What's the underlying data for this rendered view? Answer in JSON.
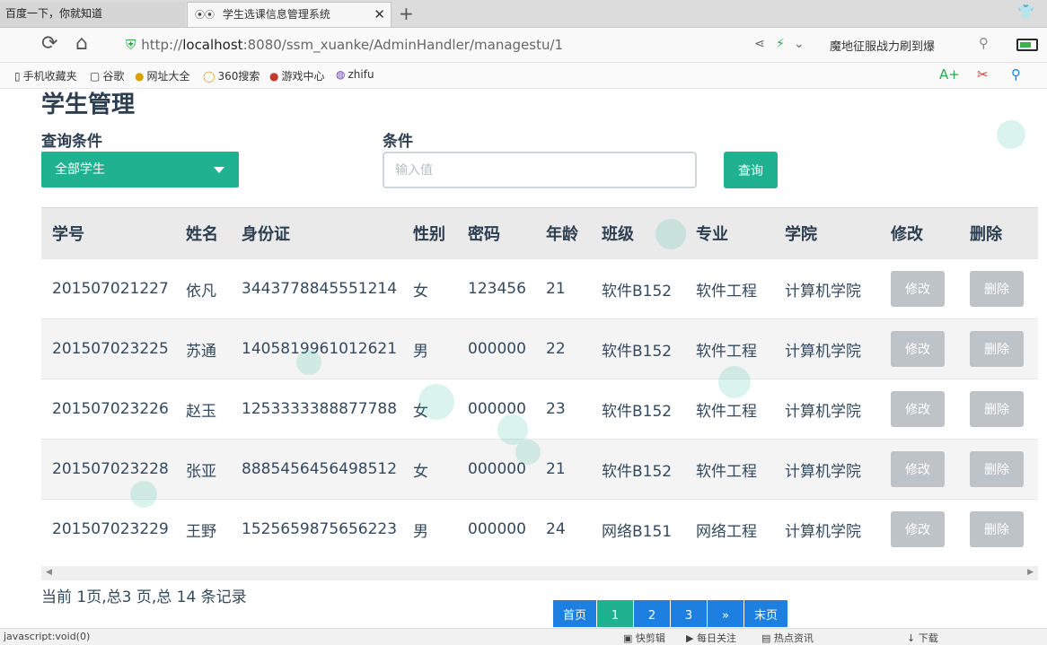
{
  "browser": {
    "tabs": [
      {
        "title": "百度一下，你就知道",
        "active": false
      },
      {
        "title": "学生选课信息管理系统",
        "active": true
      }
    ],
    "new_tab_symbol": "+",
    "url_prefix": "http://",
    "url_host": "localhost",
    "url_rest": ":8080/ssm_xuanke/AdminHandler/managestu/1",
    "search_query": "魔地征服战力刷到爆",
    "bookmarks": [
      "手机收藏夹",
      "谷歌",
      "网址大全",
      "360搜索",
      "游戏中心",
      "zhifu"
    ],
    "status_left": "javascript:void(0)",
    "status_items": [
      "快剪辑",
      "每日关注",
      "热点资讯",
      "下载"
    ]
  },
  "page": {
    "title": "学生管理",
    "query_label": "查询条件",
    "query_select_value": "全部学生",
    "condition_label": "条件",
    "condition_placeholder": "输入值",
    "query_button": "查询",
    "table": {
      "headers": [
        "学号",
        "姓名",
        "身份证",
        "性别",
        "密码",
        "年龄",
        "班级",
        "专业",
        "学院",
        "修改",
        "删除"
      ],
      "rows": [
        [
          "201507021227",
          "依凡",
          "3443778845551214",
          "女",
          "123456",
          "21",
          "软件B152",
          "软件工程",
          "计算机学院"
        ],
        [
          "201507023225",
          "苏通",
          "1405819961012621",
          "男",
          "000000",
          "22",
          "软件B152",
          "软件工程",
          "计算机学院"
        ],
        [
          "201507023226",
          "赵玉",
          "1253333388877788",
          "女",
          "000000",
          "23",
          "软件B152",
          "软件工程",
          "计算机学院"
        ],
        [
          "201507023228",
          "张亚",
          "8885456456498512",
          "女",
          "000000",
          "21",
          "软件B152",
          "软件工程",
          "计算机学院"
        ],
        [
          "201507023229",
          "王野",
          "1525659875656223",
          "男",
          "000000",
          "24",
          "网络B151",
          "网络工程",
          "计算机学院"
        ]
      ],
      "edit_label": "修改",
      "delete_label": "删除"
    },
    "records_text": "当前 1页,总3 页,总 14 条记录",
    "pagination": {
      "first": "首页",
      "pages": [
        "1",
        "2",
        "3"
      ],
      "current": "1",
      "next": "»",
      "last": "末页"
    }
  },
  "theme": {
    "accent": "#20b290",
    "pager_blue": "#1d7fe0",
    "action_gray": "#bdc3c7"
  }
}
